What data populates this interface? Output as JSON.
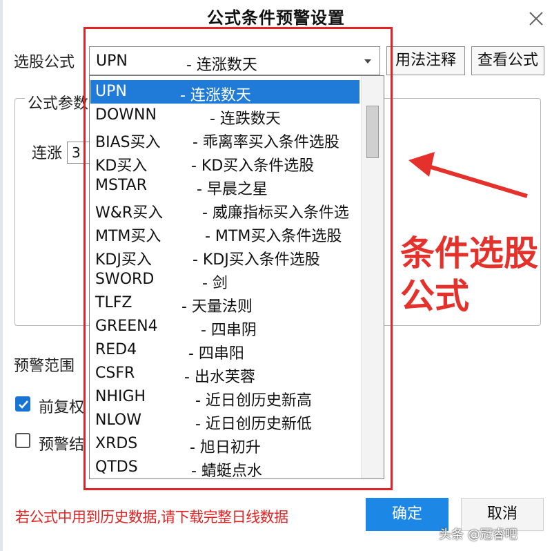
{
  "dialog": {
    "title": "公式条件预警设置",
    "formula_label": "选股公式",
    "selected": {
      "code": "UPN",
      "desc": "- 连涨数天"
    },
    "usage_button": "用法注释",
    "view_button": "查看公式",
    "params_group_title": "公式参数",
    "param_label": "连涨",
    "param_value": "3",
    "range_label": "预警范围",
    "checkbox1_label": "前复权",
    "checkbox2_label": "预警结",
    "warning_text": "若公式中用到历史数据,请下载完整日线数据",
    "ok_button": "确定",
    "cancel_button": "取消"
  },
  "dropdown": {
    "items": [
      {
        "code": "UPN",
        "desc": "- 连涨数天"
      },
      {
        "code": "DOWNN",
        "desc": "- 连跌数天"
      },
      {
        "code": "BIAS买入",
        "desc": "- 乖离率买入条件选股"
      },
      {
        "code": "KD买入",
        "desc": "- KD买入条件选股"
      },
      {
        "code": "MSTAR",
        "desc": "- 早晨之星"
      },
      {
        "code": "W&R买入",
        "desc": "- 威廉指标买入条件选"
      },
      {
        "code": "MTM买入",
        "desc": "- MTM买入条件选股"
      },
      {
        "code": "KDJ买入",
        "desc": "- KDJ买入条件选股"
      },
      {
        "code": "SWORD",
        "desc": "- 剑"
      },
      {
        "code": "TLFZ",
        "desc": "- 天量法则"
      },
      {
        "code": "GREEN4",
        "desc": "- 四串阴"
      },
      {
        "code": "RED4",
        "desc": "- 四串阳"
      },
      {
        "code": "CSFR",
        "desc": "- 出水芙蓉"
      },
      {
        "code": "NHIGH",
        "desc": "- 近日创历史新高"
      },
      {
        "code": "NLOW",
        "desc": "- 近日创历史新低"
      },
      {
        "code": "XRDS",
        "desc": "- 旭日初升"
      },
      {
        "code": "QTDS",
        "desc": "- 蜻蜓点水"
      }
    ]
  },
  "annotation": {
    "line1": "条件选股",
    "line2": "公式",
    "color": "#e5312b"
  },
  "watermark": "头条 @冠睿吧",
  "colors": {
    "accent": "#1c87e4",
    "selection": "#1f7ad8",
    "highlight_red": "#e12323"
  }
}
